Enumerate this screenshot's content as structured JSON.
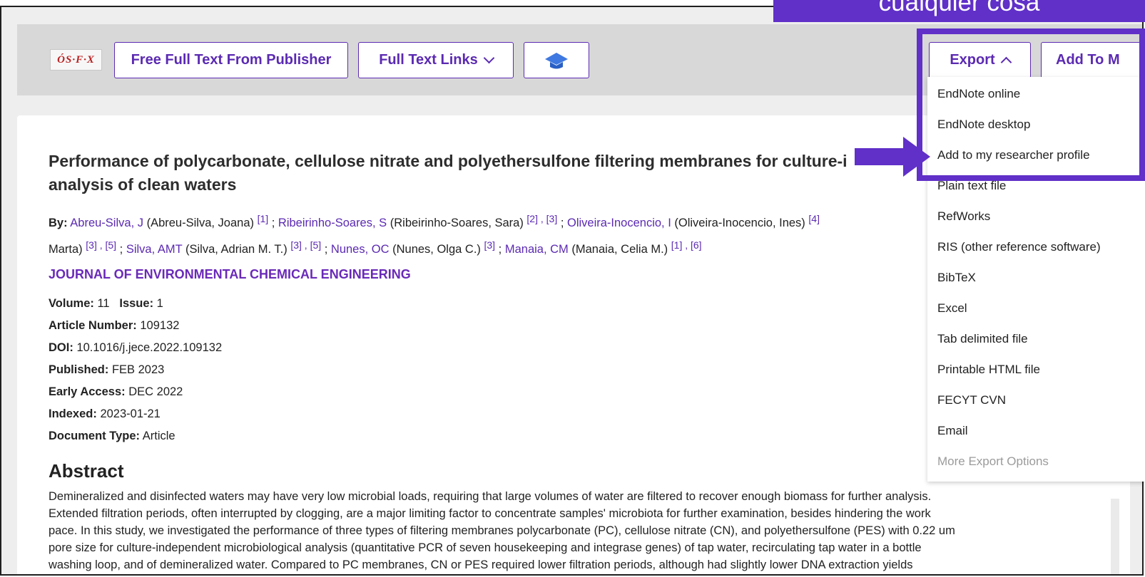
{
  "overlay": {
    "text": "cualquier cosa"
  },
  "toolbar": {
    "sfx_logo": "ÓS·F·X",
    "free_full_text": "Free Full Text From Publisher",
    "full_text_links": "Full Text Links",
    "export": "Export",
    "add_to_my_list": "Add To M"
  },
  "article": {
    "title": "Performance of polycarbonate, cellulose nitrate and polyethersulfone filtering membranes for culture-i",
    "title_line2": "analysis of clean waters",
    "by_label": "By:",
    "authors": [
      {
        "short": "Abreu-Silva, J",
        "full": " (Abreu-Silva, Joana) ",
        "refs": "[1]",
        "sep": " ; "
      },
      {
        "short": "Ribeirinho-Soares, S",
        "full": " (Ribeirinho-Soares, Sara) ",
        "refs": "[2] , [3]",
        "sep": " ; "
      },
      {
        "short": "Oliveira-Inocencio, I",
        "full": " (Oliveira-Inocencio, Ines) ",
        "refs": "[4]",
        "sep": ""
      }
    ],
    "authors_line2_prefix": "Marta) ",
    "authors_line2_prefix_refs": "[3] , [5]",
    "authors2": [
      {
        "short": "Silva, AMT",
        "full": " (Silva, Adrian M. T.) ",
        "refs": "[3] , [5]",
        "sep": " ; "
      },
      {
        "short": "Nunes, OC",
        "full": " (Nunes, Olga C.) ",
        "refs": "[3]",
        "sep": " ; "
      },
      {
        "short": "Manaia, CM",
        "full": " (Manaia, Celia M.) ",
        "refs": "[1] , [6]",
        "sep": ""
      }
    ],
    "journal": "JOURNAL OF ENVIRONMENTAL CHEMICAL ENGINEERING",
    "volume_label": "Volume:",
    "volume": "11",
    "issue_label": "Issue:",
    "issue": "1",
    "article_number_label": "Article Number:",
    "article_number": "109132",
    "doi_label": "DOI:",
    "doi": "10.1016/j.jece.2022.109132",
    "published_label": "Published:",
    "published": "FEB 2023",
    "early_access_label": "Early Access:",
    "early_access": "DEC 2022",
    "indexed_label": "Indexed:",
    "indexed": "2023-01-21",
    "doc_type_label": "Document Type:",
    "doc_type": "Article",
    "abstract_heading": "Abstract",
    "abstract_lines": [
      "Demineralized and disinfected waters may have very low microbial loads, requiring that large volumes of water are filtered to recover enough biomass for further analysis.",
      "Extended filtration periods, often interrupted by clogging, are a major limiting factor to concentrate samples' microbiota for further examination, besides hindering the work",
      "pace. In this study, we investigated the performance of three types of filtering membranes polycarbonate (PC), cellulose nitrate (CN), and polyethersulfone (PES) with 0.22 um",
      "pore size for culture-independent microbiological analysis (quantitative PCR of seven housekeeping and integrase genes) of tap water, recirculating tap water in a bottle",
      "washing loop, and of demineralized water. Compared to PC membranes, CN or PES required lower filtration periods, although had slightly lower DNA extraction yields"
    ]
  },
  "export_menu": {
    "items": [
      "EndNote online",
      "EndNote desktop",
      "Add to my researcher profile",
      "Plain text file",
      "RefWorks",
      "RIS (other reference software)",
      "BibTeX",
      "Excel",
      "Tab delimited file",
      "Printable HTML file",
      "FECYT CVN",
      "Email",
      "More Export Options"
    ]
  },
  "colors": {
    "accent": "#5b2ab2",
    "overlay": "#6030c8"
  }
}
